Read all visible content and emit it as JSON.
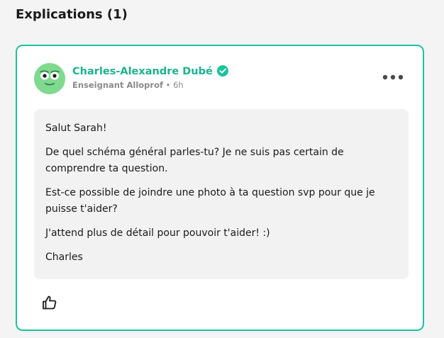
{
  "section": {
    "title": "Explications (1)"
  },
  "answer": {
    "author": {
      "name": "Charles-Alexandre Dubé",
      "role": "Enseignant Alloprof",
      "separator": "•",
      "time": "6h",
      "avatar_icon": "green-mascot-avatar",
      "verified_icon": "verified-check-icon"
    },
    "paragraphs": [
      "Salut Sarah!",
      "De quel schéma général parles-tu? Je ne suis pas certain de comprendre ta question.",
      "Est-ce possible de joindre une photo à ta question svp pour que je puisse t'aider?",
      "J'attend plus de détail pour pouvoir t'aider! :)",
      "Charles"
    ],
    "actions": {
      "more_icon": "more-horizontal-icon",
      "like_icon": "thumbs-up-icon"
    }
  },
  "colors": {
    "accent": "#1bc49a",
    "author_name": "#1bb38e",
    "avatar_bg": "#7fd98f",
    "bubble_bg": "#f2f2f2",
    "page_bg": "#f4f4f4"
  }
}
